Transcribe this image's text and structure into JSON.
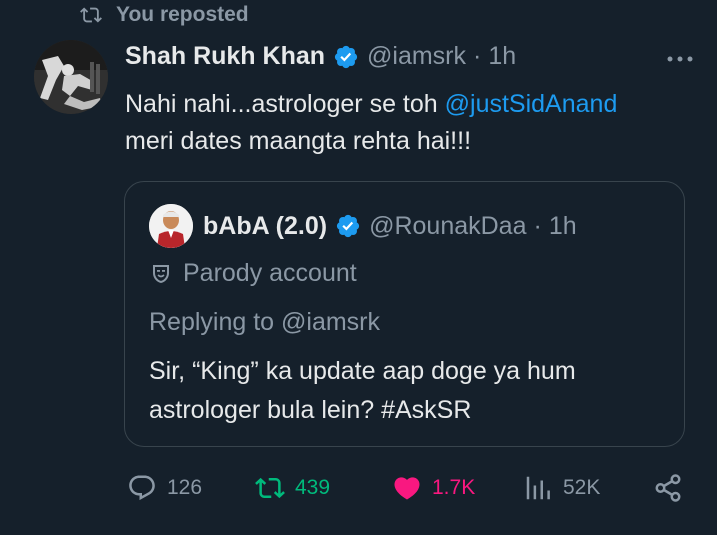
{
  "repost": {
    "label": "You reposted"
  },
  "tweet": {
    "name": "Shah Rukh Khan",
    "handle": "@iamsrk",
    "separator": "·",
    "time": "1h",
    "text_part1": "Nahi nahi...astrologer se toh ",
    "mention": "@justSidAnand",
    "text_part2": "meri dates maangta rehta hai!!!"
  },
  "quote": {
    "name": "bAbA (2.0)",
    "handle": "@RounakDaa",
    "separator": "·",
    "time": "1h",
    "parody_label": "Parody account",
    "replying_to": "Replying to @iamsrk",
    "text_line1": "Sir, “King” ka update aap doge ya hum",
    "text_line2": "astrologer bula lein? #AskSR"
  },
  "actions": {
    "replies": "126",
    "reposts": "439",
    "likes": "1.7K",
    "views": "52K"
  },
  "colors": {
    "background": "#15202b",
    "accent_blue": "#1d9bf0",
    "repost_green": "#00ba7c",
    "like_pink": "#f91880",
    "muted": "#8b98a5",
    "border": "#38444d"
  },
  "icons": {
    "repost": "repost-icon",
    "verified": "verified-badge-icon",
    "more": "more-options-icon",
    "reply": "reply-icon",
    "like": "heart-icon",
    "views": "views-chart-icon",
    "share": "share-icon",
    "parody": "theater-mask-icon"
  }
}
